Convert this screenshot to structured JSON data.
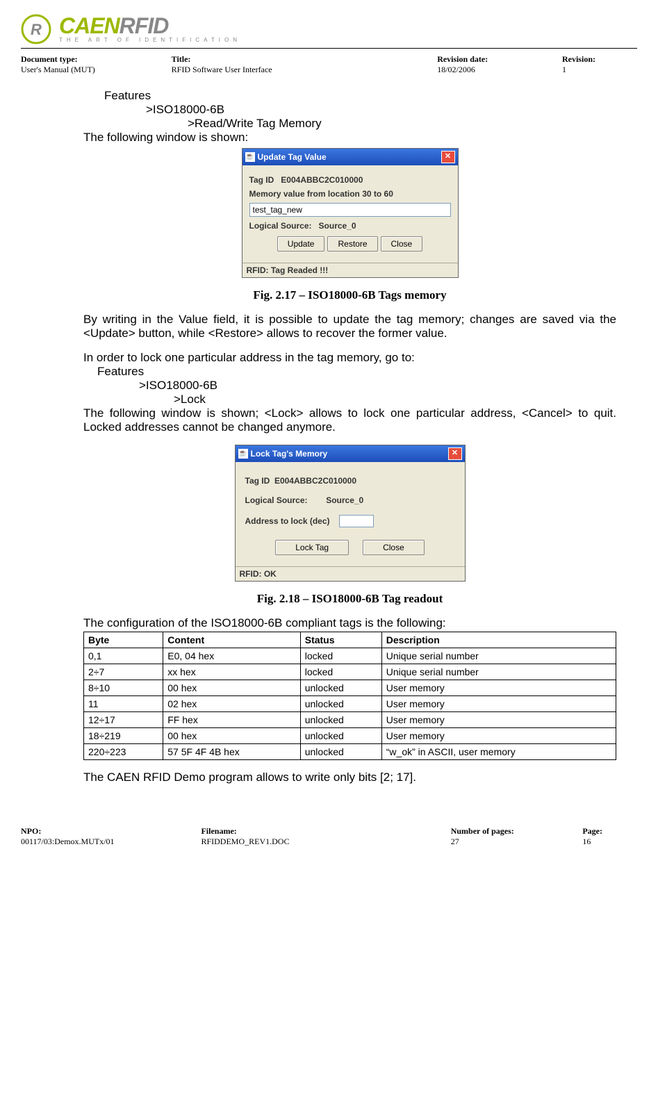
{
  "logo": {
    "name": "CAENRFID",
    "sub": "THE ART OF IDENTIFICATION"
  },
  "doc_header": {
    "doc_type_label": "Document type:",
    "doc_type_value": "User's Manual (MUT)",
    "title_label": "Title:",
    "title_value": "RFID Software User Interface",
    "rev_date_label": "Revision date:",
    "rev_date_value": "18/02/2006",
    "rev_label": "Revision:",
    "rev_value": "1"
  },
  "nav1": {
    "l1": "Features",
    "l2": ">ISO18000-6B",
    "l3": ">Read/Write Tag Memory"
  },
  "text_after_nav1": "The following window is shown:",
  "dialog1": {
    "title": "Update Tag Value",
    "tag_id_label": "Tag ID",
    "tag_id_value": "E004ABBC2C010000",
    "mem_label": "Memory value from location 30 to 60",
    "input_value": "test_tag_new",
    "src_label": "Logical Source:",
    "src_value": "Source_0",
    "b_update": "Update",
    "b_restore": "Restore",
    "b_close": "Close",
    "status": "RFID: Tag Readed !!!"
  },
  "caption1": "Fig. 2.17 – ISO18000-6B Tags memory",
  "para1": "By writing in the Value field, it is possible to update the tag memory; changes are saved via the <Update> button, while <Restore> allows to recover the former value.",
  "para2": "In order to lock one particular address in the tag memory, go to:",
  "nav2": {
    "l1": "Features",
    "l2": ">ISO18000-6B",
    "l3": ">Lock"
  },
  "para3": "The following window is shown; <Lock> allows to lock one particular address, <Cancel> to quit. Locked addresses cannot be changed anymore.",
  "dialog2": {
    "title": "Lock Tag's Memory",
    "tag_id_label": "Tag ID",
    "tag_id_value": "E004ABBC2C010000",
    "src_label": "Logical Source:",
    "src_value": "Source_0",
    "addr_label": "Address to lock (dec)",
    "b_lock": "Lock Tag",
    "b_close": "Close",
    "status": "RFID: OK"
  },
  "caption2": "Fig. 2.18 – ISO18000-6B Tag readout",
  "table_intro": "The configuration of the ISO18000-6B compliant tags is the following:",
  "table": {
    "headers": [
      "Byte",
      "Content",
      "Status",
      "Description"
    ],
    "rows": [
      [
        "0,1",
        "E0, 04 hex",
        "locked",
        "Unique serial number"
      ],
      [
        "2÷7",
        "xx hex",
        "locked",
        "Unique serial number"
      ],
      [
        "8÷10",
        "00 hex",
        "unlocked",
        "User memory"
      ],
      [
        "11",
        "02 hex",
        "unlocked",
        "User memory"
      ],
      [
        "12÷17",
        "FF hex",
        "unlocked",
        "User memory"
      ],
      [
        "18÷219",
        "00 hex",
        "unlocked",
        "User memory"
      ],
      [
        "220÷223",
        "57 5F 4F 4B hex",
        "unlocked",
        "“w_ok” in ASCII, user memory"
      ]
    ]
  },
  "final_line": "The CAEN RFID Demo program allows to write only bits [2; 17].",
  "footer": {
    "npo_label": "NPO:",
    "npo_value": "00117/03:Demox.MUTx/01",
    "file_label": "Filename:",
    "file_value": "RFIDDEMO_REV1.DOC",
    "pages_label": "Number of pages:",
    "pages_value": "27",
    "page_label": "Page:",
    "page_value": "16"
  }
}
